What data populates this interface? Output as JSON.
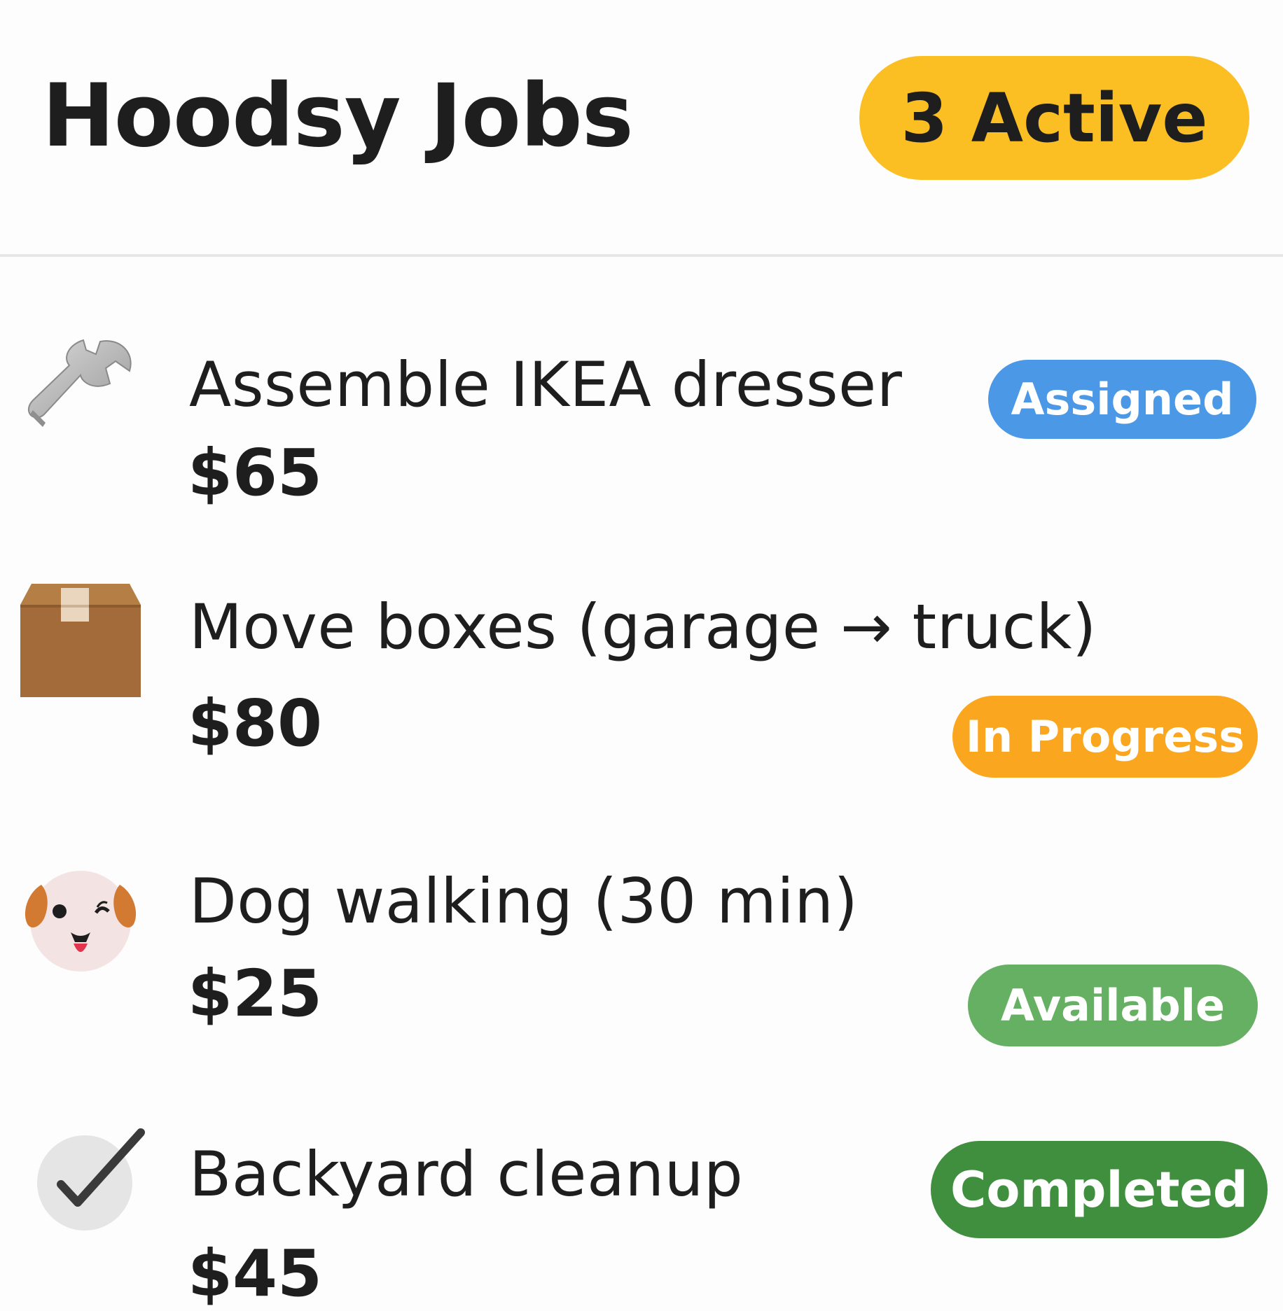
{
  "header": {
    "title": "Hoodsy Jobs",
    "active_badge": "3 Active",
    "active_badge_color": "#fbbf24"
  },
  "jobs": [
    {
      "icon": "wrench-icon",
      "title": "Assemble IKEA dresser",
      "price": "$65",
      "status": "Assigned",
      "status_color": "#4a98e6"
    },
    {
      "icon": "package-box-icon",
      "title": "Move boxes (garage → truck)",
      "price": "$80",
      "status": "In Progress",
      "status_color": "#fba61f"
    },
    {
      "icon": "dog-face-icon",
      "title": "Dog walking (30 min)",
      "price": "$25",
      "status": "Available",
      "status_color": "#65b062"
    },
    {
      "icon": "checkmark-circle-icon",
      "title": "Backyard cleanup",
      "price": "$45",
      "status": "Completed",
      "status_color": "#3f8f3f"
    }
  ]
}
